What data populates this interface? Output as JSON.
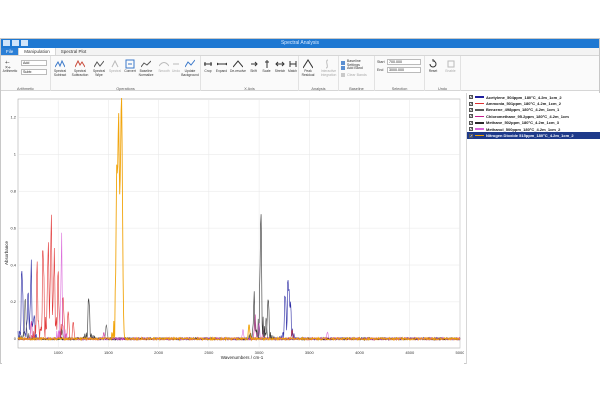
{
  "window": {
    "title": "Spectral Analysis"
  },
  "tabs": [
    {
      "label": "File"
    },
    {
      "label": "Manipulation"
    },
    {
      "label": "Spectral Plot"
    }
  ],
  "ribbon": {
    "arithmetic": {
      "label": "Arithmetic",
      "btn_arithmetic": "Arithmetic",
      "field_a": "Add",
      "field_b": "Subtr."
    },
    "operations": {
      "label": "Operations",
      "buttons": [
        "Spectral Subtract",
        "Spectral Subtraction",
        "Spectral Wipe",
        "Spectral",
        "Convert",
        "Baseline Normalize",
        "Smooth",
        "Undo",
        "Update Background"
      ]
    },
    "xaxis": {
      "label": "X Axis",
      "buttons": [
        "Crop",
        "Expand",
        "De-resolve",
        "Shift",
        "Scale",
        "Stretch",
        "Match"
      ]
    },
    "analysis": {
      "label": "Analysis",
      "buttons": [
        "Peak Residual",
        "Interactive Integration"
      ]
    },
    "baseline": {
      "label": "Baseline",
      "items": [
        "Baseline Settings",
        "Add Band",
        "Clear Bands"
      ]
    },
    "selection": {
      "label": "Selection",
      "start_label": "Start",
      "start_value": "700.000",
      "end_label": "End",
      "end_value": "3000.000"
    },
    "undo": {
      "label": "Undo",
      "buttons": [
        "Reset",
        "Enable"
      ]
    }
  },
  "chart_data": {
    "type": "line",
    "xlabel": "Wavenumbers / cm-1",
    "ylabel": "Absorbance",
    "xlim": [
      600,
      5000
    ],
    "ylim": [
      -0.05,
      1.3
    ],
    "x_ticks": [
      "1000",
      "1500",
      "2000",
      "2500",
      "3000",
      "3500",
      "4000",
      "4500",
      "5000"
    ],
    "y_ticks": [
      "0",
      "0.2",
      "0.4",
      "0.6",
      "0.8",
      "1",
      "1.2"
    ],
    "grid": true,
    "series": [
      {
        "name": "Acetylene_504ppm_180°C_4.2m_1cm_2",
        "color": "#1f1f9e",
        "peaks": [
          [
            640,
            0.37
          ],
          [
            700,
            0.2
          ],
          [
            730,
            0.34
          ],
          [
            760,
            0.12
          ],
          [
            3260,
            0.23
          ],
          [
            3290,
            0.3
          ],
          [
            3310,
            0.17
          ]
        ]
      },
      {
        "name": "Ammonia_501ppm_180°C_4.2m_1cm_2",
        "color": "#e03030",
        "peaks": [
          [
            790,
            0.35
          ],
          [
            850,
            0.48
          ],
          [
            900,
            0.45
          ],
          [
            930,
            0.55
          ],
          [
            960,
            0.38
          ],
          [
            1000,
            0.3
          ],
          [
            1050,
            0.2
          ],
          [
            1100,
            0.15
          ],
          [
            1150,
            0.1
          ],
          [
            3330,
            0.05
          ]
        ]
      },
      {
        "name": "Benzene_498ppm_180°C_4.2m_1cm_1",
        "color": "#5a5a5a",
        "peaks": [
          [
            673,
            0.2
          ],
          [
            1038,
            0.05
          ],
          [
            1480,
            0.08
          ],
          [
            3070,
            0.12
          ]
        ]
      },
      {
        "name": "Chloromethane_95.2ppm_180°C_4.2m_1cm",
        "color": "#c41a8e",
        "peaks": [
          [
            732,
            0.1
          ],
          [
            1015,
            0.05
          ],
          [
            1455,
            0.03
          ],
          [
            2960,
            0.13
          ],
          [
            3040,
            0.05
          ]
        ]
      },
      {
        "name": "Methane_502ppm_180°C_4.2m_1cm_3",
        "color": "#2a2a2a",
        "peaks": [
          [
            1305,
            0.22
          ],
          [
            3017,
            0.65
          ],
          [
            2950,
            0.2
          ],
          [
            3090,
            0.22
          ]
        ]
      },
      {
        "name": "Methanol_500ppm_180°C_4.2m_1cm_2",
        "color": "#d966d9",
        "peaks": [
          [
            1033,
            0.46
          ],
          [
            2840,
            0.05
          ],
          [
            3000,
            0.09
          ],
          [
            3680,
            0.04
          ]
        ]
      },
      {
        "name": "Nitrogen Dioxide 515ppm_180°C_4.2m_1cm_2",
        "color": "#f0a000",
        "peaks": [
          [
            1600,
            1.12
          ],
          [
            1630,
            1.28
          ],
          [
            1580,
            0.62
          ],
          [
            2900,
            0.08
          ]
        ]
      }
    ]
  }
}
